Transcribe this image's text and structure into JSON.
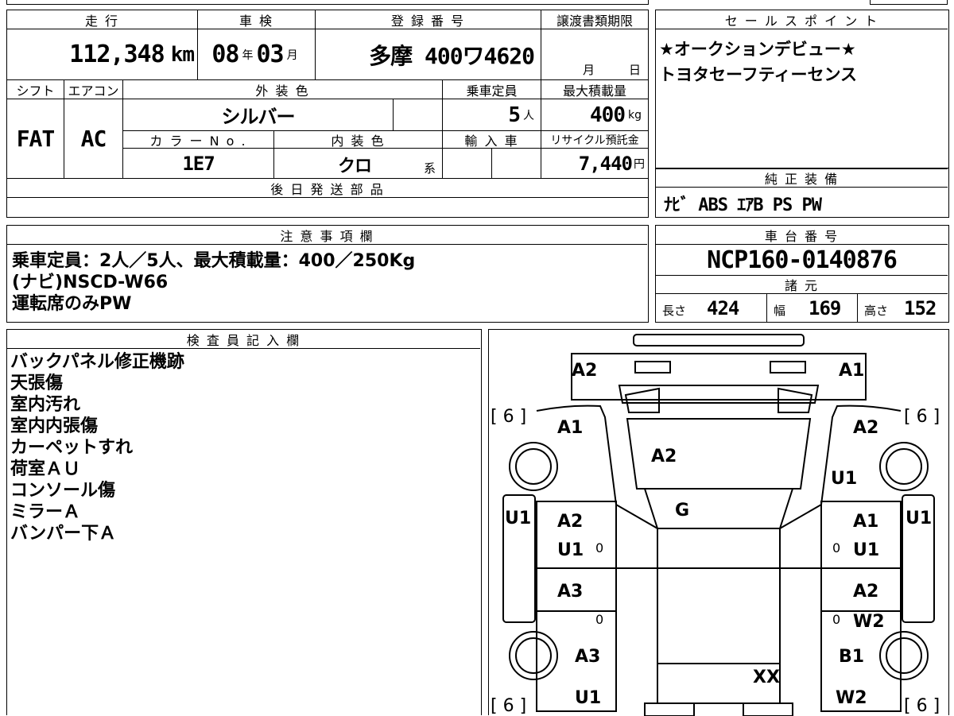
{
  "top_table": {
    "headers": {
      "mileage": "走 行",
      "shaken": "車 検",
      "reg_number": "登 録 番 号",
      "transfer_deadline": "譲渡書類期限",
      "shift": "シフト",
      "aircon": "エアコン",
      "exterior_color": "外 装 色",
      "capacity": "乗車定員",
      "max_load": "最大積載量",
      "color_no": "カ ラ ー N o .",
      "interior_color": "内 装 色",
      "import": "輸 入 車",
      "recycle_fee": "リサイクル預託金",
      "later_parts": "後 日 発 送 部 品"
    },
    "mileage_value": "112,348",
    "mileage_unit": "km",
    "shaken_year": "08",
    "shaken_year_unit": "年",
    "shaken_month": "03",
    "shaken_month_unit": "月",
    "reg_number": "多摩 400ワ4620",
    "deadline_month": "月",
    "deadline_day": "日",
    "shift": "FAT",
    "aircon": "AC",
    "exterior_color": "シルバー",
    "capacity": "5",
    "capacity_unit": "人",
    "max_load": "400",
    "max_load_unit": "kg",
    "color_no": "1E7",
    "interior_color": "クロ",
    "interior_suffix": "系",
    "recycle_fee": "7,440",
    "recycle_unit": "円"
  },
  "sales_points": {
    "header": "セ ー ル ス ポ イ ン ト",
    "lines": [
      "★オークションデビュー★",
      "トヨタセーフティーセンス"
    ]
  },
  "genuine_equipment": {
    "header": "純 正 装 備",
    "value": "ﾅﾋﾞ ABS ｴｱB PS PW"
  },
  "notes": {
    "header": "注 意 事 項 欄",
    "lines": [
      "乗車定員：2人／5人、最大積載量：400／250Kg",
      "(ナビ)NSCD-W66",
      "運転席のみPW"
    ]
  },
  "chassis": {
    "header": "車 台 番 号",
    "value": "NCP160-0140876"
  },
  "specs": {
    "header": "諸 元",
    "length_label": "長さ",
    "length": "424",
    "width_label": "幅",
    "width": "169",
    "height_label": "高さ",
    "height": "152"
  },
  "inspector": {
    "header": "検 査 員 記 入 欄",
    "lines": [
      "バックパネル修正機跡",
      "天張傷",
      "室内汚れ",
      "室内内張傷",
      "カーペットすれ",
      "荷室ＡＵ",
      "コンソール傷",
      "ミラーＡ",
      "バンパー下Ａ"
    ]
  },
  "diagram": {
    "labels": {
      "rear_left": "A2",
      "rear_right": "A1",
      "tire_rl": "[ 6 ]",
      "tire_rr": "[ 6 ]",
      "tire_fl": "[ 6 ]",
      "tire_fr": "[ 6 ]",
      "quarter_left": "A1",
      "quarter_right": "A2",
      "roof_rear": "A2",
      "quarter_right_lower": "U1",
      "roof": "G",
      "side_left": "U1",
      "side_right": "U1",
      "rear_door_left_a": "A2",
      "rear_door_left_b": "U1",
      "rear_door_right_a": "A1",
      "rear_door_right_b": "U1",
      "front_door_left": "A3",
      "front_door_right_a": "A2",
      "front_door_right_b": "W2",
      "fender_left": "A3",
      "fender_right": "B1",
      "hood": "XX",
      "front_left": "U1",
      "front_right": "W2",
      "zero1": "0",
      "zero2": "0",
      "zero3": "0",
      "zero4": "0"
    }
  }
}
